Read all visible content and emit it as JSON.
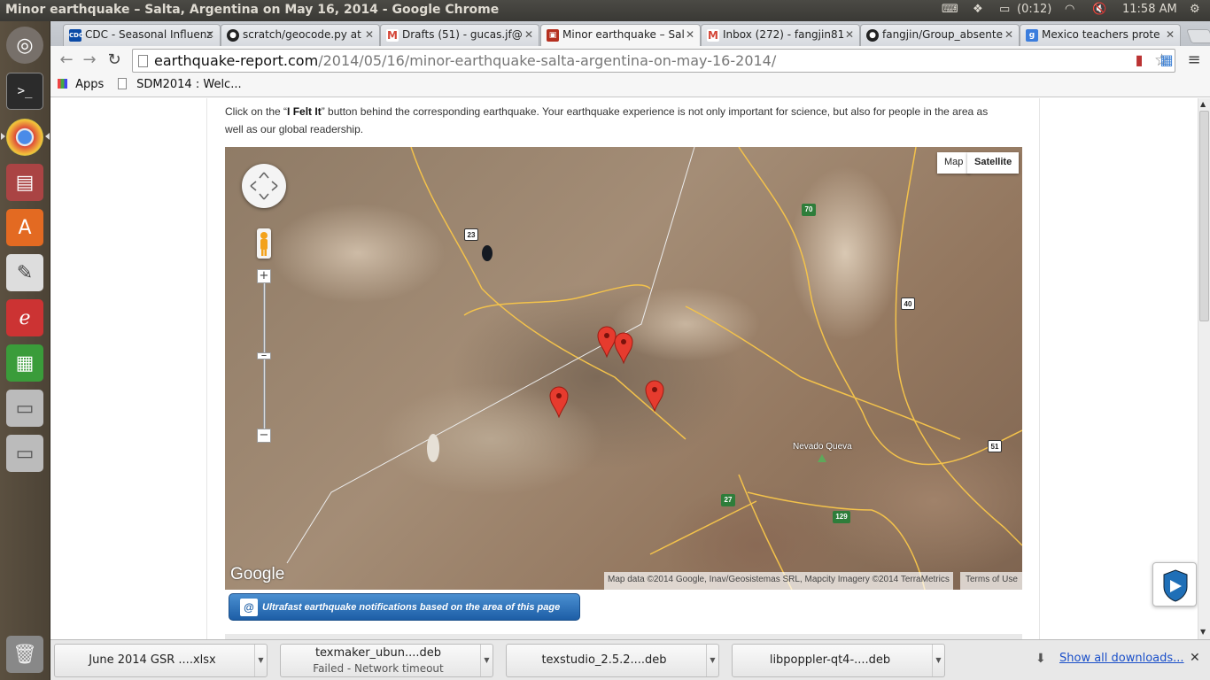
{
  "window": {
    "title": "Minor earthquake – Salta, Argentina on May 16, 2014 - Google Chrome"
  },
  "system_tray": {
    "battery": "(0:12)",
    "clock": "11:58 AM"
  },
  "tabs": [
    {
      "label": "CDC - Seasonal Influenz",
      "icon": "CDC",
      "color": "#0a4aa6"
    },
    {
      "label": "scratch/geocode.py at",
      "icon": "github-icon",
      "color": "#222222"
    },
    {
      "label": "Drafts (51) - gucas.jf@",
      "icon": "gmail-icon",
      "color": "#d44638"
    },
    {
      "label": "Minor earthquake – Sal",
      "icon": "earthquake-report-icon",
      "color": "#b5301f"
    },
    {
      "label": "Inbox (272) - fangjin81",
      "icon": "gmail-icon",
      "color": "#d44638"
    },
    {
      "label": "fangjin/Group_absente",
      "icon": "github-icon",
      "color": "#222222"
    },
    {
      "label": "Mexico teachers prote",
      "icon": "google-icon",
      "color": "#3b7ddd"
    }
  ],
  "address_bar": {
    "host": "earthquake-report.com",
    "path": "/2014/05/16/minor-earthquake-salta-argentina-on-may-16-2014/"
  },
  "bookmarks": {
    "apps_label": "Apps",
    "item1": "SDM2014 : Welc..."
  },
  "page": {
    "intro_line1_pre": "Click on the “",
    "intro_bold": "I Felt It",
    "intro_line1_post": "” button behind the corresponding earthquake. Your earthquake experience is not only important for science, but also for people in the area as",
    "intro_line2": "well as our global readership."
  },
  "map": {
    "type_map": "Map",
    "type_satellite": "Satellite",
    "logo": "Google",
    "attribution": "Map data ©2014 Google, Inav/Geosistemas SRL, Mapcity Imagery ©2014 TerraMetrics",
    "terms": "Terms of Use",
    "place": "Nevado Queva",
    "road_shields": [
      "23",
      "70",
      "40",
      "51",
      "27",
      "129"
    ]
  },
  "notify_button": "Ultrafast earthquake notifications based on the area of this page",
  "downloads": [
    {
      "name": "June 2014 GSR ....xlsx",
      "status": ""
    },
    {
      "name": "texmaker_ubun....deb",
      "status": "Failed - Network timeout"
    },
    {
      "name": "texstudio_2.5.2....deb",
      "status": ""
    },
    {
      "name": "libpoppler-qt4-....deb",
      "status": ""
    }
  ],
  "show_all_downloads": "Show all downloads..."
}
